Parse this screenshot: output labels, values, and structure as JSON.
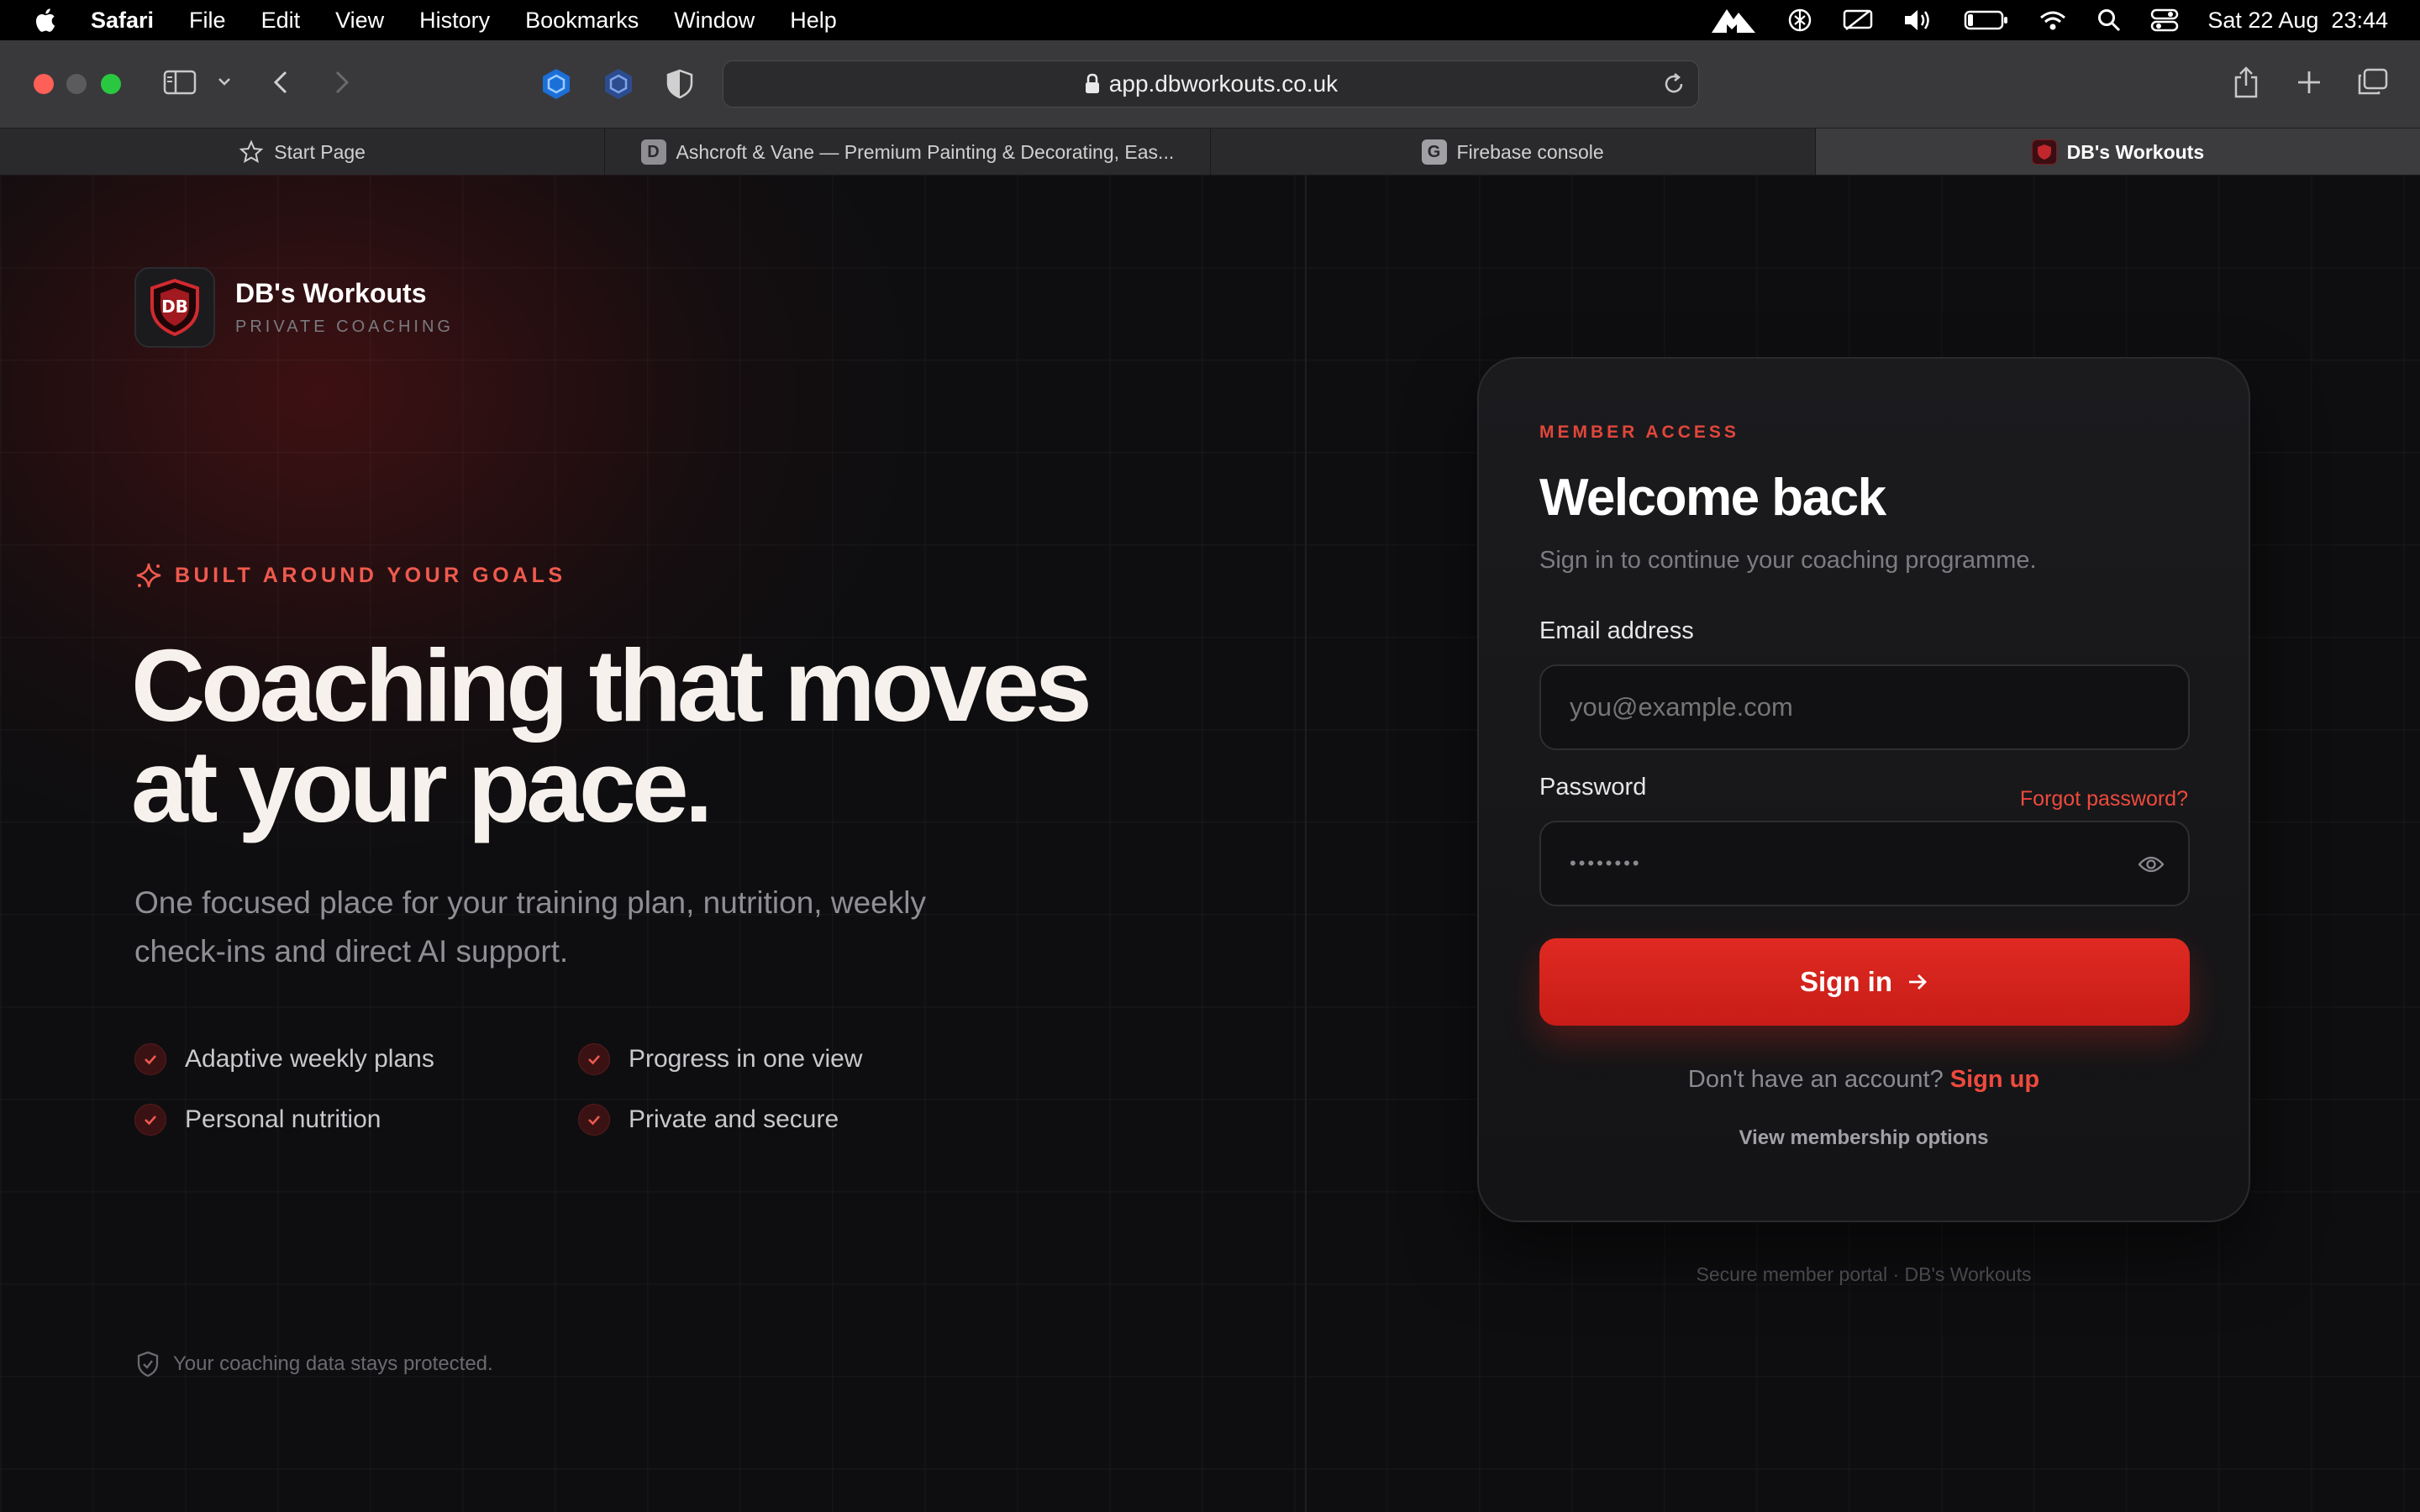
{
  "menubar": {
    "app_name": "Safari",
    "items": [
      "File",
      "Edit",
      "View",
      "History",
      "Bookmarks",
      "Window",
      "Help"
    ],
    "clock": "Sat 22 Aug  23:44"
  },
  "browser": {
    "url": "app.dbworkouts.co.uk",
    "tabs": [
      {
        "label": "Start Page",
        "favicon": ""
      },
      {
        "label": "Ashcroft & Vane — Premium Painting & Decorating, Eas...",
        "favicon": "D"
      },
      {
        "label": "Firebase console",
        "favicon": "G"
      },
      {
        "label": "DB's Workouts",
        "favicon": ""
      }
    ]
  },
  "brand": {
    "name": "DB's Workouts",
    "tagline": "PRIVATE COACHING"
  },
  "hero": {
    "eyebrow": "BUILT AROUND YOUR GOALS",
    "title_line1": "Coaching that moves",
    "title_line2": "at your pace.",
    "subtitle": "One focused place for your training plan, nutrition, weekly check-ins and direct AI support.",
    "features": [
      "Adaptive weekly plans",
      "Progress in one view",
      "Personal nutrition",
      "Private and secure"
    ],
    "protected_note": "Your coaching data stays protected."
  },
  "login": {
    "eyebrow": "MEMBER ACCESS",
    "title": "Welcome back",
    "subtitle": "Sign in to continue your coaching programme.",
    "email_label": "Email address",
    "email_placeholder": "you@example.com",
    "password_label": "Password",
    "password_value": "••••••••",
    "forgot_label": "Forgot password?",
    "signin_label": "Sign in",
    "no_account_text": "Don't have an account?",
    "signup_label": "Sign up",
    "membership_label": "View membership options",
    "footer": "Secure member portal · DB's Workouts"
  },
  "colors": {
    "accent": "#e0261f",
    "accent_text": "#ef4a3d",
    "background": "#0e0e10"
  }
}
